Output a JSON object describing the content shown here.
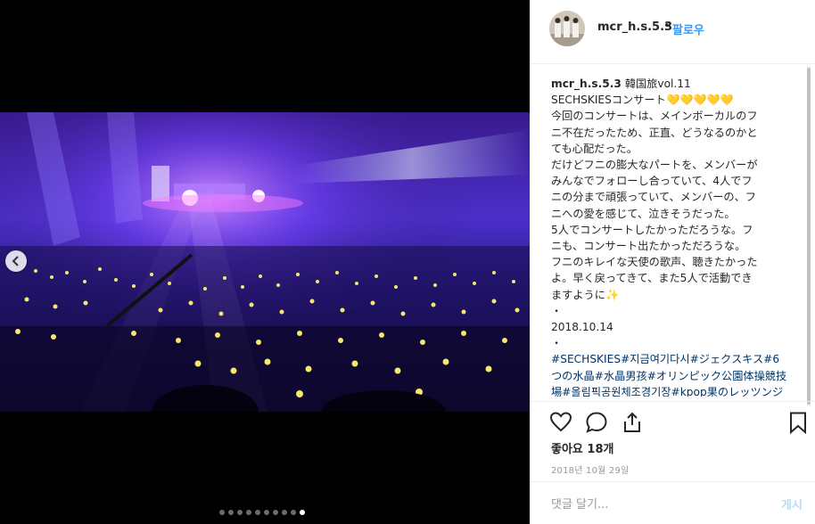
{
  "post": {
    "username": "mcr_h.s.5.3",
    "follow_sep": "•",
    "follow_label": "팔로우",
    "caption_lines": [
      "韓国旅vol.11",
      "SECHSKIESコンサート",
      "今回のコンサートは、メインボーカルのフ",
      "ニ不在だったため、正直、どうなるのかと",
      "ても心配だった。",
      "だけどフニの膨大なパートを、メンバーが",
      "みんなでフォローし合っていて、4人でフ",
      "ニの分まで頑張っていて、メンバーの、フ",
      "ニへの愛を感じて、泣きそうだった。",
      "5人でコンサートしたかっただろうな。フ",
      "ニも、コンサート出たかっただろうな。",
      "フニのキレイな天使の歌声、聴きたかった",
      "よ。早く戻ってきて、また5人で活動でき",
      "ますように",
      "・",
      "2018.10.14",
      "・"
    ],
    "heart_emoji": "💛",
    "heart_count": 5,
    "sparkle_emoji": "✨",
    "hashtags_line": "#SECHSKIES#지금여기다시#ジェクスキス#6つの水晶#水晶男孩#オリンピック公園体操競技場#올림픽공원체조경기장#kpop果のレッツンジ#은지원#이재진#김재덕",
    "likes": "좋아요 18개",
    "date": "2018년 10월 29일",
    "comment_placeholder": "댓글 달기...",
    "post_label": "게시",
    "carousel": {
      "count": 10,
      "active": 9
    }
  },
  "colors": {
    "link": "#3897f0",
    "hashtag": "#003569",
    "stage_purple": "#5b2bd6",
    "lightstick": "#f7e76a"
  },
  "icons": [
    "chevron-left-icon",
    "heart-icon",
    "comment-icon",
    "share-icon",
    "bookmark-icon"
  ]
}
